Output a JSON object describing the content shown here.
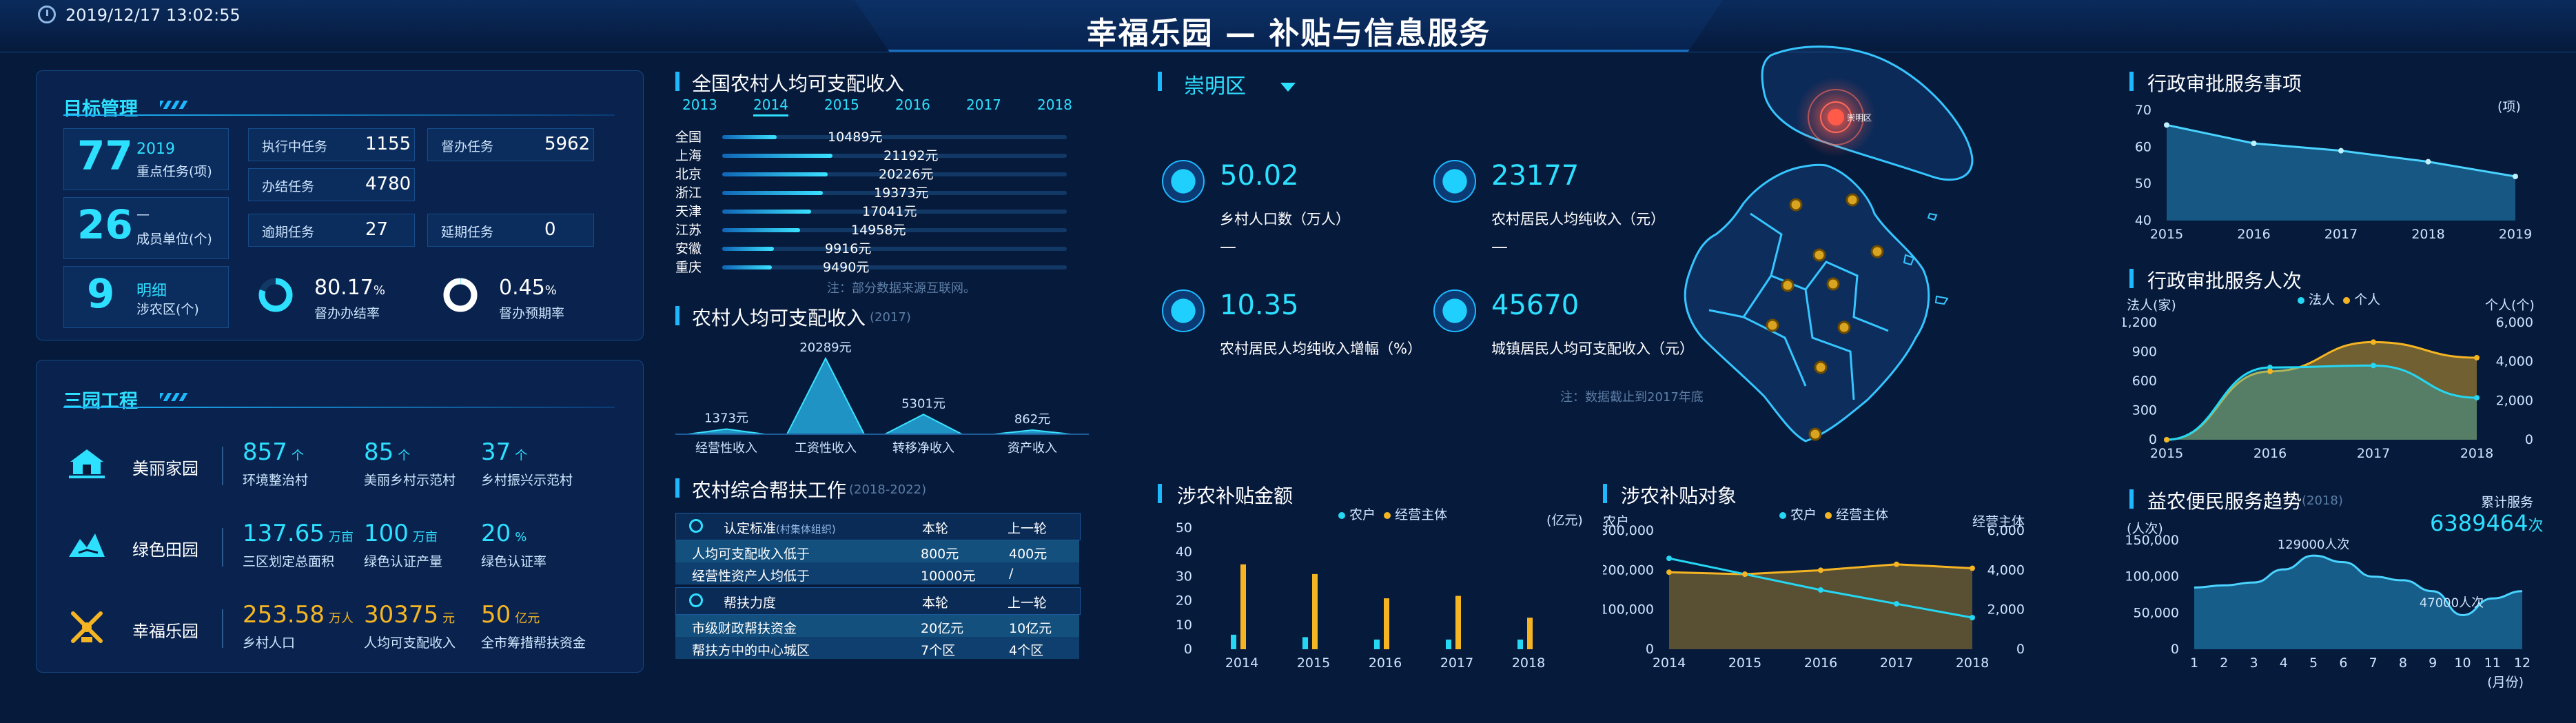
{
  "header": {
    "datetime": "2019/12/17 13:02:55",
    "title": "幸福乐园 — 补贴与信息服务"
  },
  "goal": {
    "title": "目标管理",
    "main_value": "77",
    "main_year": "2019",
    "main_label": "重点任务(项)",
    "units_value": "26",
    "units_dash": "—",
    "units_label": "成员单位(个)",
    "districts_value": "9",
    "districts_highlight": "明细",
    "districts_label": "涉农区(个)",
    "stats": [
      {
        "label": "执行中任务",
        "value": "1155"
      },
      {
        "label": "督办任务",
        "value": "5962"
      },
      {
        "label": "办结任务",
        "value": "4780"
      },
      {
        "label": "逾期任务",
        "value": "27"
      },
      {
        "label": "延期任务",
        "value": "0"
      }
    ],
    "rate1_value": "80.17",
    "rate1_unit": "%",
    "rate1_label": "督办办结率",
    "rate1_fraction": 0.8017,
    "rate2_value": "0.45",
    "rate2_unit": "%",
    "rate2_label": "督办预期率",
    "rate2_fraction": 0.0045
  },
  "three_parks": {
    "title": "三园工程",
    "rows": [
      {
        "icon": "house-icon",
        "name": "美丽家园",
        "items": [
          {
            "value": "857",
            "unit": "个",
            "label": "环境整治村"
          },
          {
            "value": "85",
            "unit": "个",
            "label": "美丽乡村示范村"
          },
          {
            "value": "37",
            "unit": "个",
            "label": "乡村振兴示范村"
          }
        ]
      },
      {
        "icon": "field-icon",
        "name": "绿色田园",
        "items": [
          {
            "value": "137.65",
            "unit": "万亩",
            "label": "三区划定总面积"
          },
          {
            "value": "100",
            "unit": "万亩",
            "label": "绿色认证产量"
          },
          {
            "value": "20",
            "unit": "%",
            "label": "绿色认证率"
          }
        ]
      },
      {
        "icon": "windmill-icon",
        "name": "幸福乐园",
        "items": [
          {
            "value": "253.58",
            "unit": "万人",
            "label": "乡村人口"
          },
          {
            "value": "30375",
            "unit": "元",
            "label": "人均可支配收入"
          },
          {
            "value": "50",
            "unit": "亿元",
            "label": "全市筹措帮扶资金"
          }
        ]
      }
    ]
  },
  "income_rank": {
    "title": "全国农村人均可支配收入",
    "years": [
      "2013",
      "2014",
      "2015",
      "2016",
      "2017",
      "2018"
    ],
    "active_year": "2014",
    "rows": [
      {
        "name": "全国",
        "value": 10489,
        "label": "10489元"
      },
      {
        "name": "上海",
        "value": 21192,
        "label": "21192元"
      },
      {
        "name": "北京",
        "value": 20226,
        "label": "20226元"
      },
      {
        "name": "浙江",
        "value": 19373,
        "label": "19373元"
      },
      {
        "name": "天津",
        "value": 17041,
        "label": "17041元"
      },
      {
        "name": "江苏",
        "value": 14958,
        "label": "14958元"
      },
      {
        "name": "安徽",
        "value": 9916,
        "label": "9916元"
      },
      {
        "name": "重庆",
        "value": 9490,
        "label": "9490元"
      }
    ],
    "note": "注：部分数据来源互联网。"
  },
  "income_composition": {
    "title": "农村人均可支配收入",
    "year": "(2017)",
    "items": [
      {
        "label": "经营性收入",
        "value": 1373,
        "value_label": "1373元"
      },
      {
        "label": "工资性收入",
        "value": 20289,
        "value_label": "20289元"
      },
      {
        "label": "转移净收入",
        "value": 5301,
        "value_label": "5301元"
      },
      {
        "label": "资产收入",
        "value": 862,
        "value_label": "862元"
      }
    ]
  },
  "assistance": {
    "title": "农村综合帮扶工作",
    "period": "(2018-2022)",
    "sections": [
      {
        "header": "认定标准",
        "header_sub": "(村集体组织)",
        "col1": "本轮",
        "col2": "上一轮",
        "rows": [
          {
            "label": "人均可支配收入低于",
            "cur": "800元",
            "prev": "400元"
          },
          {
            "label": "经营性资产人均低于",
            "cur": "10000元",
            "prev": "/"
          }
        ]
      },
      {
        "header": "帮扶力度",
        "header_sub": "",
        "col1": "本轮",
        "col2": "上一轮",
        "rows": [
          {
            "label": "市级财政帮扶资金",
            "cur": "20亿元",
            "prev": "10亿元"
          },
          {
            "label": "帮扶方中的中心城区",
            "cur": "7个区",
            "prev": "4个区"
          }
        ]
      }
    ]
  },
  "district": {
    "name": "崇明区",
    "map_marker": "崇明区",
    "kpis": [
      {
        "icon": "people-icon",
        "value": "50.02",
        "label": "乡村人口数（万人）",
        "dash": "—"
      },
      {
        "icon": "money-bag-icon",
        "value": "23177",
        "label": "农村居民人均纯收入（元）",
        "dash": "—"
      },
      {
        "icon": "yuan-growth-icon",
        "value": "10.35",
        "label": "农村居民人均纯收入增幅（%）",
        "dash": ""
      },
      {
        "icon": "yuan-card-icon",
        "value": "45670",
        "label": "城镇居民人均可支配收入（元）",
        "dash": ""
      }
    ],
    "note": "注：数据截止到2017年底"
  },
  "subsidy_amount": {
    "title": "涉农补贴金额",
    "legend": [
      "农户",
      "经营主体"
    ],
    "unit": "(亿元)",
    "colors": {
      "farmer": "#25d7f2",
      "entity": "#f5b523"
    },
    "chart_data": {
      "type": "bar",
      "categories": [
        "2014",
        "2015",
        "2016",
        "2017",
        "2018"
      ],
      "series": [
        {
          "name": "农户",
          "values": [
            6,
            5,
            4,
            4,
            4
          ]
        },
        {
          "name": "经营主体",
          "values": [
            35,
            31,
            21,
            22,
            13
          ]
        }
      ],
      "ylim": [
        0,
        50
      ],
      "yticks": [
        0,
        10,
        20,
        30,
        40,
        50
      ]
    }
  },
  "subsidy_target": {
    "title": "涉农补贴对象",
    "legend": [
      "农户",
      "经营主体"
    ],
    "left_unit": "农户",
    "right_unit": "经营主体",
    "chart_data": {
      "type": "line",
      "categories": [
        "2014",
        "2015",
        "2016",
        "2017",
        "2018"
      ],
      "series": [
        {
          "name": "农户",
          "axis": "left",
          "values": [
            230000,
            190000,
            150000,
            115000,
            80000
          ]
        },
        {
          "name": "经营主体",
          "axis": "right",
          "values": [
            3900,
            3800,
            4000,
            4300,
            4100
          ]
        }
      ],
      "ylim_left": [
        0,
        300000
      ],
      "yticks_left": [
        "0",
        "100,000",
        "200,000",
        "300,000"
      ],
      "ylim_right": [
        0,
        6000
      ],
      "yticks_right": [
        "0",
        "2,000",
        "4,000",
        "6,000"
      ]
    }
  },
  "approval_items": {
    "title": "行政审批服务事项",
    "unit": "(项)",
    "chart_data": {
      "type": "area",
      "categories": [
        "2015",
        "2016",
        "2017",
        "2018",
        "2019"
      ],
      "values": [
        66,
        61,
        59,
        56,
        52
      ],
      "ylim": [
        40,
        70
      ],
      "yticks": [
        40,
        50,
        60,
        70
      ]
    }
  },
  "approval_persons": {
    "title": "行政审批服务人次",
    "legend": [
      "法人",
      "个人"
    ],
    "left_unit": "法人(家)",
    "right_unit": "个人(个)",
    "chart_data": {
      "type": "area",
      "categories": [
        "2015",
        "2016",
        "2017",
        "2018"
      ],
      "series": [
        {
          "name": "法人",
          "axis": "left",
          "values": [
            0,
            740,
            760,
            430
          ]
        },
        {
          "name": "个人",
          "axis": "right",
          "values": [
            0,
            3500,
            5000,
            4200
          ]
        }
      ],
      "ylim_left": [
        0,
        1200
      ],
      "yticks_left": [
        "0",
        "300",
        "600",
        "900",
        "1,200"
      ],
      "ylim_right": [
        0,
        6000
      ],
      "yticks_right": [
        "0",
        "2,000",
        "4,000",
        "6,000"
      ]
    }
  },
  "convenience": {
    "title": "益农便民服务趋势",
    "year": "(2018)",
    "total_label": "累计服务",
    "total_value": "6389464",
    "total_unit": "次",
    "unit": "(人次)",
    "x_unit": "(月份)",
    "peak_label": "129000人次",
    "low_label": "47000人次",
    "chart_data": {
      "type": "area",
      "categories": [
        "1",
        "2",
        "3",
        "4",
        "5",
        "6",
        "7",
        "8",
        "9",
        "10",
        "11",
        "12"
      ],
      "values": [
        85000,
        88000,
        92000,
        110000,
        129000,
        120000,
        100000,
        95000,
        80000,
        47000,
        70000,
        80000
      ],
      "ylim": [
        0,
        150000
      ],
      "yticks": [
        "0",
        "50,000",
        "100,000",
        "150,000"
      ]
    }
  }
}
